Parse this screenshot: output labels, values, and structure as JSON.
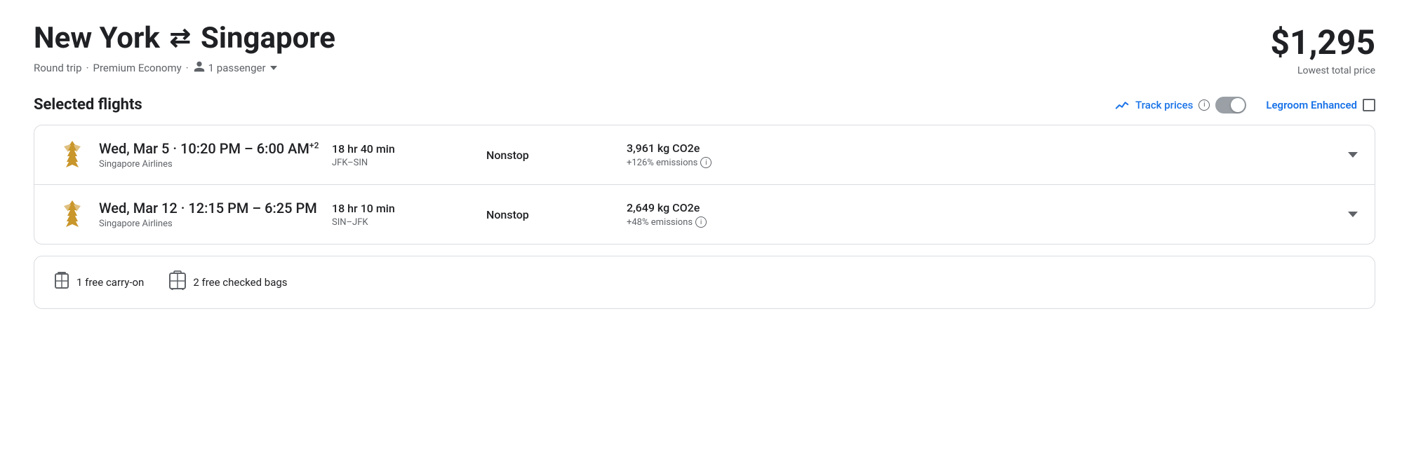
{
  "header": {
    "origin": "New York",
    "destination": "Singapore",
    "trip_type": "Round trip",
    "cabin": "Premium Economy",
    "passengers": "1 passenger",
    "price": "$1,295",
    "price_label": "Lowest total price"
  },
  "section": {
    "title": "Selected flights",
    "track_prices_label": "Track prices",
    "legroom_label": "Legroom Enhanced"
  },
  "flights": [
    {
      "date": "Wed, Mar 5",
      "time": "10:20 PM – 6:00 AM",
      "time_suffix": "+2",
      "airline": "Singapore Airlines",
      "duration": "18 hr 40 min",
      "route": "JFK–SIN",
      "stops": "Nonstop",
      "co2": "3,961 kg CO2e",
      "emissions": "+126% emissions"
    },
    {
      "date": "Wed, Mar 12",
      "time": "12:15 PM – 6:25 PM",
      "time_suffix": "",
      "airline": "Singapore Airlines",
      "duration": "18 hr 10 min",
      "route": "SIN–JFK",
      "stops": "Nonstop",
      "co2": "2,649 kg CO2e",
      "emissions": "+48% emissions"
    }
  ],
  "bags": [
    {
      "label": "1 free carry-on"
    },
    {
      "label": "2 free checked bags"
    }
  ],
  "icons": {
    "info": "i",
    "arrow_both": "⇄",
    "person": "👤"
  }
}
